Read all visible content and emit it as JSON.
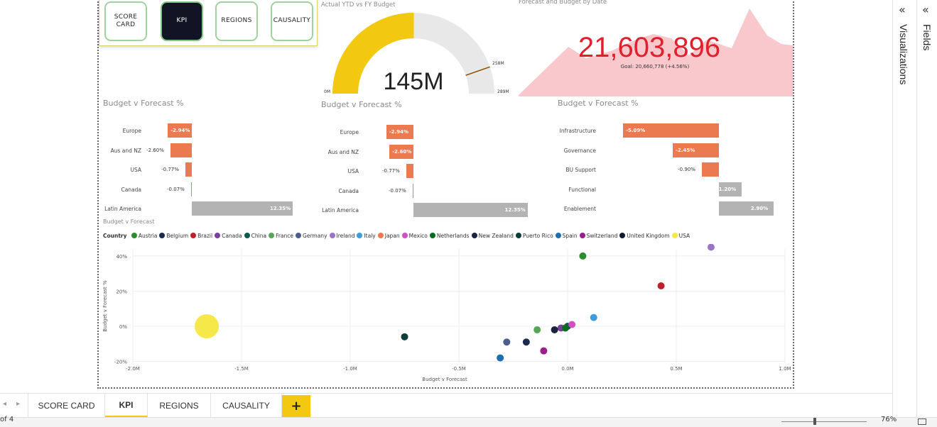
{
  "nav_buttons": [
    {
      "label_line1": "SCORE",
      "label_line2": "CARD",
      "active": false
    },
    {
      "label_line1": "KPI",
      "label_line2": "",
      "active": true
    },
    {
      "label_line1": "REGIONS",
      "label_line2": "",
      "active": false
    },
    {
      "label_line1": "CAUSALITY",
      "label_line2": "",
      "active": false
    }
  ],
  "gauge": {
    "title": "Actual YTD vs FY Budget",
    "value_label": "145M",
    "min_label": "0M",
    "max_label": "289M",
    "target_label": "258M",
    "value": 145,
    "min": 0,
    "max": 289,
    "target": 258,
    "fill_color": "#f2c811",
    "track_color": "#e8e8e8",
    "target_color": "#8a4b00"
  },
  "kpi": {
    "title": "Forecast and Budget by Date",
    "value_label": "21,603,896",
    "trend_mark": "!",
    "goal_label": "Goal: 20,660,778 (+4.56%)",
    "value_color": "#e0202b",
    "area_color": "#f8c8cc"
  },
  "bar_charts": [
    {
      "title": "Budget v Forecast %",
      "rows": [
        {
          "category": "Europe",
          "value": -2.94,
          "label": "-2.94%"
        },
        {
          "category": "Aus and NZ",
          "value": -2.6,
          "label": "-2.60%"
        },
        {
          "category": "USA",
          "value": -0.77,
          "label": "-0.77%"
        },
        {
          "category": "Canada",
          "value": -0.07,
          "label": "-0.07%"
        },
        {
          "category": "Latin America",
          "value": 12.35,
          "label": "12.35%"
        }
      ]
    },
    {
      "title": "Budget v Forecast %",
      "rows": [
        {
          "category": "Europe",
          "value": -2.94,
          "label": "-2.94%"
        },
        {
          "category": "Aus and NZ",
          "value": -2.6,
          "label": "-2.60%"
        },
        {
          "category": "USA",
          "value": -0.77,
          "label": "-0.77%"
        },
        {
          "category": "Canada",
          "value": -0.07,
          "label": "-0.07%"
        },
        {
          "category": "Latin America",
          "value": 12.35,
          "label": "12.35%"
        }
      ]
    },
    {
      "title": "Budget v Forecast %",
      "rows": [
        {
          "category": "Infrastructure",
          "value": -5.09,
          "label": "-5.09%"
        },
        {
          "category": "Governance",
          "value": -2.45,
          "label": "-2.45%"
        },
        {
          "category": "BU Support",
          "value": -0.9,
          "label": "-0.90%"
        },
        {
          "category": "Functional",
          "value": 1.2,
          "label": "1.20%"
        },
        {
          "category": "Enablement",
          "value": 2.9,
          "label": "2.90%"
        }
      ]
    }
  ],
  "bar_colors": {
    "negative": "#ec7a50",
    "positive": "#b3b3b3"
  },
  "scatter": {
    "title": "Budget v Forecast",
    "legend_title": "Country",
    "xlabel": "Budget v Forecast",
    "ylabel": "Budget v Forecast %",
    "x_ticks": [
      "-2.0M",
      "-1.5M",
      "-1.0M",
      "-0.5M",
      "0.0M",
      "0.5M",
      "1.0M"
    ],
    "y_ticks": [
      "40%",
      "20%",
      "0%",
      "-20%"
    ]
  },
  "chart_data": {
    "type": "scatter",
    "title": "Budget v Forecast",
    "xlabel": "Budget v Forecast",
    "ylabel": "Budget v Forecast %",
    "xlim": [
      -2.0,
      1.0
    ],
    "ylim": [
      -20,
      45
    ],
    "x_unit": "M",
    "y_unit": "%",
    "legend_title": "Country",
    "legend_position": "top",
    "grid": true,
    "series": [
      {
        "name": "Austria",
        "color": "#2e8b2e",
        "x": [
          0.07
        ],
        "y": [
          40
        ],
        "size": [
          1
        ]
      },
      {
        "name": "Belgium",
        "color": "#1b2a4e",
        "x": [
          -0.19
        ],
        "y": [
          -9
        ],
        "size": [
          1
        ]
      },
      {
        "name": "Brazil",
        "color": "#c0202a",
        "x": [
          0.43
        ],
        "y": [
          23
        ],
        "size": [
          1
        ]
      },
      {
        "name": "Canada",
        "color": "#7b3fa0",
        "x": [
          -0.03
        ],
        "y": [
          -1
        ],
        "size": [
          1
        ]
      },
      {
        "name": "China",
        "color": "#0f5a4a",
        "x": [
          0.0
        ],
        "y": [
          0
        ],
        "size": [
          1
        ]
      },
      {
        "name": "France",
        "color": "#56a656",
        "x": [
          -0.14
        ],
        "y": [
          -2
        ],
        "size": [
          1
        ]
      },
      {
        "name": "Germany",
        "color": "#4a5f8a",
        "x": [
          -0.28
        ],
        "y": [
          -9
        ],
        "size": [
          1
        ]
      },
      {
        "name": "Ireland",
        "color": "#9b74c8",
        "x": [
          0.66
        ],
        "y": [
          45
        ],
        "size": [
          1
        ]
      },
      {
        "name": "Italy",
        "color": "#3d9be0",
        "x": [
          0.12
        ],
        "y": [
          5
        ],
        "size": [
          1
        ]
      },
      {
        "name": "Japan",
        "color": "#ec7a50",
        "x": [],
        "y": [],
        "size": []
      },
      {
        "name": "Mexico",
        "color": "#d24fc4",
        "x": [
          0.02
        ],
        "y": [
          1
        ],
        "size": [
          1
        ]
      },
      {
        "name": "Netherlands",
        "color": "#0b6b1f",
        "x": [
          -0.01
        ],
        "y": [
          -1
        ],
        "size": [
          1
        ]
      },
      {
        "name": "New Zealand",
        "color": "#1a2340",
        "x": [
          -0.06
        ],
        "y": [
          -2
        ],
        "size": [
          1
        ]
      },
      {
        "name": "Puerto Rico",
        "color": "#0e3d3a",
        "x": [
          -0.75
        ],
        "y": [
          -6
        ],
        "size": [
          1
        ]
      },
      {
        "name": "Spain",
        "color": "#1e6fb0",
        "x": [
          -0.31
        ],
        "y": [
          -18
        ],
        "size": [
          1
        ]
      },
      {
        "name": "Switzerland",
        "color": "#9a1d8a",
        "x": [
          -0.11
        ],
        "y": [
          -14
        ],
        "size": [
          1
        ]
      },
      {
        "name": "United Kingdom",
        "color": "#141a30",
        "x": [],
        "y": [],
        "size": []
      },
      {
        "name": "USA",
        "color": "#f7e84a",
        "x": [
          -1.66
        ],
        "y": [
          0
        ],
        "size": [
          4
        ]
      }
    ]
  },
  "tabs": [
    {
      "label": "SCORE CARD",
      "active": false
    },
    {
      "label": "KPI",
      "active": true
    },
    {
      "label": "REGIONS",
      "active": false
    },
    {
      "label": "CAUSALITY",
      "active": false
    }
  ],
  "add_tab_label": "+",
  "status": {
    "page_label": "of 4",
    "zoom_label": "76%"
  },
  "panes": {
    "visualizations": "Visualizations",
    "fields": "Fields"
  }
}
